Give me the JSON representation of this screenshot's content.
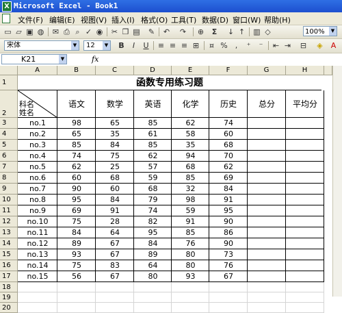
{
  "window": {
    "title": "Microsoft Excel - Book1",
    "app_icon": "X"
  },
  "menu": [
    "文件(F)",
    "编辑(E)",
    "视图(V)",
    "插入(I)",
    "格式(O)",
    "工具(T)",
    "数据(D)",
    "窗口(W)",
    "帮助(H)"
  ],
  "toolbar": {
    "zoom": "100%",
    "buttons": [
      "new-icon",
      "open-icon",
      "save-icon",
      "permission-icon",
      "email-icon",
      "print-icon",
      "print-preview-icon",
      "spelling-icon",
      "research-icon",
      "cut-icon",
      "copy-icon",
      "paste-icon",
      "format-painter-icon",
      "undo-icon",
      "redo-icon",
      "hyperlink-icon",
      "autosum-icon",
      "sort-asc-icon",
      "sort-desc-icon",
      "chart-icon",
      "drawing-icon"
    ]
  },
  "format": {
    "font": "宋体",
    "size": "12",
    "bold": "B",
    "italic": "I",
    "underline": "U",
    "percent": "%",
    "comma": ","
  },
  "formula_bar": {
    "name_box": "K21",
    "fx": "fx",
    "value": ""
  },
  "sheet": {
    "columns": [
      "A",
      "B",
      "C",
      "D",
      "E",
      "F",
      "G",
      "H"
    ],
    "title": "函数专用练习题",
    "header_subject": "科名",
    "header_name": "姓名",
    "headers": [
      "语文",
      "数学",
      "英语",
      "化学",
      "历史",
      "总分",
      "平均分"
    ],
    "rows": [
      [
        "no.1",
        "98",
        "65",
        "85",
        "62",
        "74",
        "",
        ""
      ],
      [
        "no.2",
        "65",
        "35",
        "61",
        "58",
        "60",
        "",
        ""
      ],
      [
        "no.3",
        "85",
        "84",
        "85",
        "35",
        "68",
        "",
        ""
      ],
      [
        "no.4",
        "74",
        "75",
        "62",
        "94",
        "70",
        "",
        ""
      ],
      [
        "no.5",
        "62",
        "25",
        "57",
        "68",
        "62",
        "",
        ""
      ],
      [
        "no.6",
        "60",
        "68",
        "59",
        "85",
        "69",
        "",
        ""
      ],
      [
        "no.7",
        "90",
        "60",
        "68",
        "32",
        "84",
        "",
        ""
      ],
      [
        "no.8",
        "95",
        "84",
        "79",
        "98",
        "91",
        "",
        ""
      ],
      [
        "no.9",
        "69",
        "91",
        "74",
        "59",
        "95",
        "",
        ""
      ],
      [
        "no.10",
        "75",
        "28",
        "82",
        "91",
        "90",
        "",
        ""
      ],
      [
        "no.11",
        "84",
        "64",
        "95",
        "85",
        "86",
        "",
        ""
      ],
      [
        "no.12",
        "89",
        "67",
        "84",
        "76",
        "90",
        "",
        ""
      ],
      [
        "no.13",
        "93",
        "67",
        "89",
        "80",
        "73",
        "",
        ""
      ],
      [
        "no.14",
        "75",
        "83",
        "64",
        "80",
        "76",
        "",
        ""
      ],
      [
        "no.15",
        "56",
        "67",
        "80",
        "93",
        "67",
        "",
        ""
      ]
    ],
    "row_numbers": [
      "1",
      "2",
      "3",
      "4",
      "5",
      "6",
      "7",
      "8",
      "9",
      "10",
      "11",
      "12",
      "13",
      "14",
      "15",
      "16",
      "17",
      "18",
      "19",
      "20"
    ]
  },
  "colors": {
    "titlebar": "#1d4fcf",
    "chrome": "#ece9d8",
    "gridline": "#d4d4d4"
  }
}
